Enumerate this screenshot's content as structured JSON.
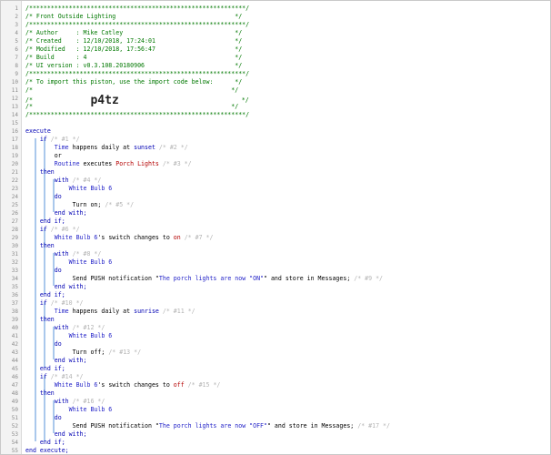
{
  "lines": [
    {
      "n": "1",
      "t": [
        [
          "/************************************************************/",
          "comment"
        ]
      ]
    },
    {
      "n": "2",
      "t": [
        [
          "/* Front Outside Lighting                                 */",
          "comment"
        ]
      ]
    },
    {
      "n": "3",
      "t": [
        [
          "/************************************************************/",
          "comment"
        ]
      ]
    },
    {
      "n": "4",
      "t": [
        [
          "/* Author     : Mike Catley                               */",
          "comment"
        ]
      ]
    },
    {
      "n": "5",
      "t": [
        [
          "/* Created    : 12/10/2018, 17:24:01                      */",
          "comment"
        ]
      ]
    },
    {
      "n": "6",
      "t": [
        [
          "/* Modified   : 12/10/2018, 17:56:47                      */",
          "comment"
        ]
      ]
    },
    {
      "n": "7",
      "t": [
        [
          "/* Build      : 4                                         */",
          "comment"
        ]
      ]
    },
    {
      "n": "8",
      "t": [
        [
          "/* UI version : v0.3.108.20180906                         */",
          "comment"
        ]
      ]
    },
    {
      "n": "9",
      "t": [
        [
          "/************************************************************/",
          "comment"
        ]
      ]
    },
    {
      "n": "10",
      "t": [
        [
          "/* To import this piston, use the import code below:      */",
          "comment"
        ]
      ]
    },
    {
      "n": "11",
      "t": [
        [
          "/*                                                       */",
          "comment"
        ]
      ]
    },
    {
      "n": "12",
      "t": [
        [
          "/*                ",
          "comment"
        ],
        [
          "p4tz",
          "big"
        ],
        [
          "                                  */",
          "comment"
        ]
      ]
    },
    {
      "n": "13",
      "t": [
        [
          "/*                                                       */",
          "comment"
        ]
      ]
    },
    {
      "n": "14",
      "t": [
        [
          "/************************************************************/",
          "comment"
        ]
      ]
    },
    {
      "n": "15",
      "t": []
    },
    {
      "n": "16",
      "t": [
        [
          "execute",
          "kw"
        ]
      ]
    },
    {
      "n": "17",
      "t": [
        [
          "    if ",
          "kw"
        ],
        [
          "/* #1 */",
          "dim"
        ]
      ]
    },
    {
      "n": "18",
      "t": [
        [
          "        Time",
          "blue"
        ],
        [
          " happens daily at ",
          ""
        ],
        [
          "sunset",
          "kw"
        ],
        [
          " /* #2 */",
          "dim"
        ]
      ]
    },
    {
      "n": "19",
      "t": [
        [
          "        or",
          ""
        ]
      ]
    },
    {
      "n": "20",
      "t": [
        [
          "        Routine",
          "blue"
        ],
        [
          " executes ",
          ""
        ],
        [
          "Porch Lights",
          "red"
        ],
        [
          " /* #3 */",
          "dim"
        ]
      ]
    },
    {
      "n": "21",
      "t": [
        [
          "    then",
          "kw"
        ]
      ]
    },
    {
      "n": "22",
      "t": [
        [
          "        with ",
          "kw"
        ],
        [
          "/* #4 */",
          "dim"
        ]
      ]
    },
    {
      "n": "23",
      "t": [
        [
          "            White Bulb 6",
          "blue"
        ]
      ]
    },
    {
      "n": "24",
      "t": [
        [
          "        do",
          "kw"
        ]
      ]
    },
    {
      "n": "25",
      "t": [
        [
          "             Turn on; ",
          ""
        ],
        [
          "/* #5 */",
          "dim"
        ]
      ]
    },
    {
      "n": "26",
      "t": [
        [
          "        end with;",
          "kw"
        ]
      ]
    },
    {
      "n": "27",
      "t": [
        [
          "    end if;",
          "kw"
        ]
      ]
    },
    {
      "n": "28",
      "t": [
        [
          "    if ",
          "kw"
        ],
        [
          "/* #6 */",
          "dim"
        ]
      ]
    },
    {
      "n": "29",
      "t": [
        [
          "        White Bulb 6",
          "blue"
        ],
        [
          "'s switch changes to ",
          ""
        ],
        [
          "on",
          "red"
        ],
        [
          " /* #7 */",
          "dim"
        ]
      ]
    },
    {
      "n": "30",
      "t": [
        [
          "    then",
          "kw"
        ]
      ]
    },
    {
      "n": "31",
      "t": [
        [
          "        with ",
          "kw"
        ],
        [
          "/* #8 */",
          "dim"
        ]
      ]
    },
    {
      "n": "32",
      "t": [
        [
          "            White Bulb 6",
          "blue"
        ]
      ]
    },
    {
      "n": "33",
      "t": [
        [
          "        do",
          "kw"
        ]
      ]
    },
    {
      "n": "34",
      "t": [
        [
          "             Send PUSH notification \"",
          "",
          ""
        ],
        [
          "The porch lights are now \"ON\"",
          "blue"
        ],
        [
          "\" and store in Messages; ",
          ""
        ],
        [
          "/* #9 */",
          "dim"
        ]
      ]
    },
    {
      "n": "35",
      "t": [
        [
          "        end with;",
          "kw"
        ]
      ]
    },
    {
      "n": "36",
      "t": [
        [
          "    end if;",
          "kw"
        ]
      ]
    },
    {
      "n": "37",
      "t": [
        [
          "    if ",
          "kw"
        ],
        [
          "/* #10 */",
          "dim"
        ]
      ]
    },
    {
      "n": "38",
      "t": [
        [
          "        Time",
          "blue"
        ],
        [
          " happens daily at ",
          ""
        ],
        [
          "sunrise",
          "kw"
        ],
        [
          " /* #11 */",
          "dim"
        ]
      ]
    },
    {
      "n": "39",
      "t": [
        [
          "    then",
          "kw"
        ]
      ]
    },
    {
      "n": "40",
      "t": [
        [
          "        with ",
          "kw"
        ],
        [
          "/* #12 */",
          "dim"
        ]
      ]
    },
    {
      "n": "41",
      "t": [
        [
          "            White Bulb 6",
          "blue"
        ]
      ]
    },
    {
      "n": "42",
      "t": [
        [
          "        do",
          "kw"
        ]
      ]
    },
    {
      "n": "43",
      "t": [
        [
          "             Turn off; ",
          ""
        ],
        [
          "/* #13 */",
          "dim"
        ]
      ]
    },
    {
      "n": "44",
      "t": [
        [
          "        end with;",
          "kw"
        ]
      ]
    },
    {
      "n": "45",
      "t": [
        [
          "    end if;",
          "kw"
        ]
      ]
    },
    {
      "n": "46",
      "t": [
        [
          "    if ",
          "kw"
        ],
        [
          "/* #14 */",
          "dim"
        ]
      ]
    },
    {
      "n": "47",
      "t": [
        [
          "        White Bulb 6",
          "blue"
        ],
        [
          "'s switch changes to ",
          ""
        ],
        [
          "off",
          "red"
        ],
        [
          " /* #15 */",
          "dim"
        ]
      ]
    },
    {
      "n": "48",
      "t": [
        [
          "    then",
          "kw"
        ]
      ]
    },
    {
      "n": "49",
      "t": [
        [
          "        with ",
          "kw"
        ],
        [
          "/* #16 */",
          "dim"
        ]
      ]
    },
    {
      "n": "50",
      "t": [
        [
          "            White Bulb 6",
          "blue"
        ]
      ]
    },
    {
      "n": "51",
      "t": [
        [
          "        do",
          "kw"
        ]
      ]
    },
    {
      "n": "52",
      "t": [
        [
          "             Send PUSH notification \"",
          ""
        ],
        [
          "The porch lights are now \"OFF\"",
          "blue"
        ],
        [
          "\" and store in Messages; ",
          ""
        ],
        [
          "/* #17 */",
          "dim"
        ]
      ]
    },
    {
      "n": "53",
      "t": [
        [
          "        end with;",
          "kw"
        ]
      ]
    },
    {
      "n": "54",
      "t": [
        [
          "    end if;",
          "kw"
        ]
      ]
    },
    {
      "n": "55",
      "t": [
        [
          "end execute;",
          "kw"
        ]
      ]
    }
  ]
}
